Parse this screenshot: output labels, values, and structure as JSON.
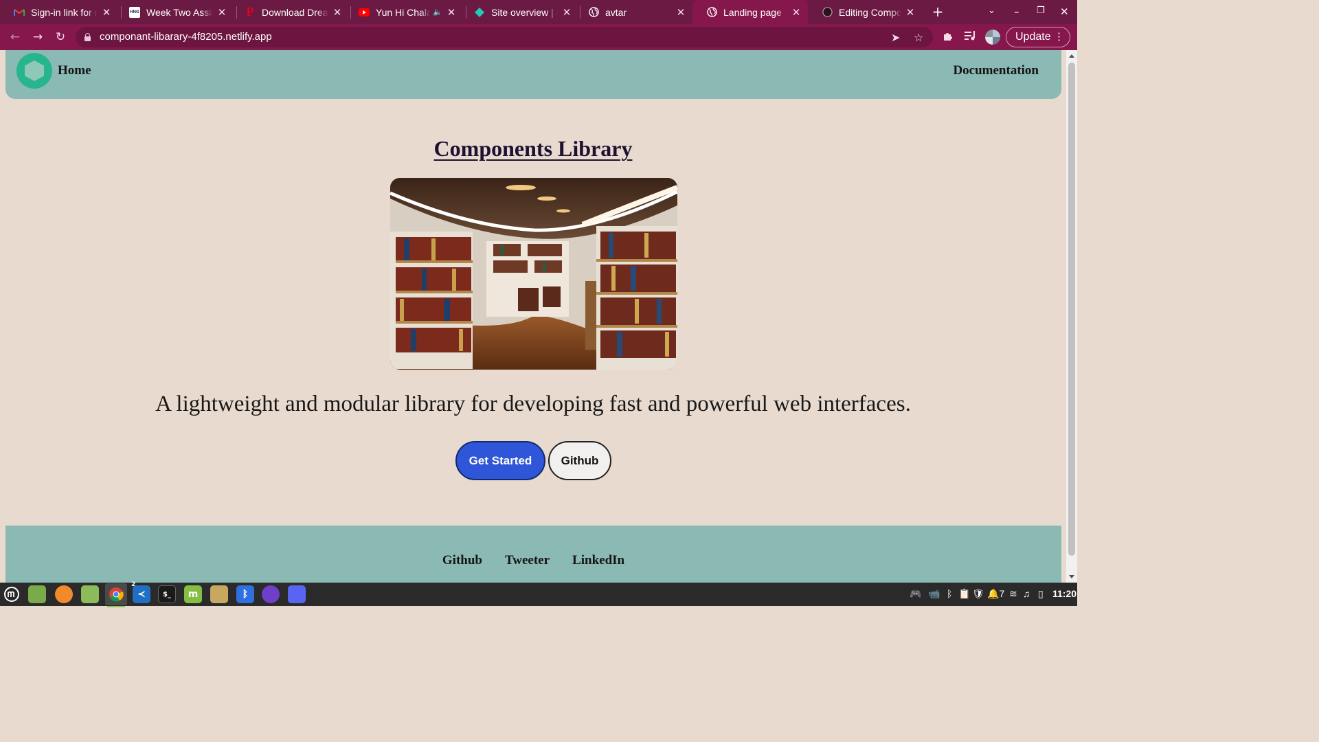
{
  "browser": {
    "tabs": [
      {
        "title": "Sign-in link for ne",
        "icon": "gmail-icon",
        "active": false
      },
      {
        "title": "Week Two Assignme",
        "icon": "hng-icon",
        "active": false
      },
      {
        "title": "Download Dreams",
        "icon": "pinterest-icon",
        "active": false
      },
      {
        "title": "Yun Hi Chala",
        "icon": "youtube-icon",
        "active": false,
        "audio": true
      },
      {
        "title": "Site overview | co",
        "icon": "netlify-icon",
        "active": false
      },
      {
        "title": "avtar",
        "icon": "globe-icon",
        "active": false
      },
      {
        "title": "Landing page",
        "icon": "globe-icon",
        "active": true
      },
      {
        "title": "Editing Componen",
        "icon": "github-icon",
        "active": false
      }
    ],
    "url": "componant-libarary-4f8205.netlify.app",
    "update_label": "Update",
    "colors": {
      "frame": "#6b1a44",
      "toolbar": "#86174c"
    }
  },
  "page": {
    "nav": {
      "home": "Home",
      "docs": "Documentation"
    },
    "title": "Components Library",
    "hero_image_alt": "Library bookshelves",
    "tagline": "A lightweight and modular library for developing fast and powerful web interfaces.",
    "buttons": {
      "primary": "Get Started",
      "secondary": "Github"
    },
    "footer_links": [
      "Github",
      "Tweeter",
      "LinkedIn"
    ],
    "colors": {
      "background": "#e8dacf",
      "header": "#8bb9b3",
      "primary_button": "#2f56d8"
    }
  },
  "taskbar": {
    "apps": [
      "mint-menu-icon",
      "files-icon",
      "firefox-icon",
      "folder-icon",
      "chrome-icon",
      "vscode-icon",
      "terminal-icon",
      "mint-update-icon",
      "archive-icon",
      "bluetooth-icon",
      "github-desktop-icon",
      "discord-icon"
    ],
    "vscode_badge": "2",
    "tray": {
      "notification_count": "7"
    },
    "clock": "11:20"
  }
}
